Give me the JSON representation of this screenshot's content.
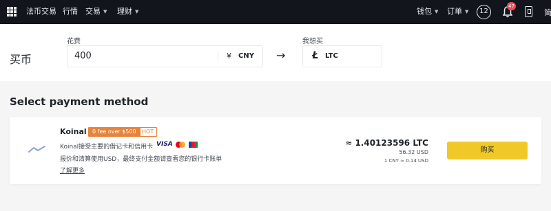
{
  "nav": {
    "left_items": [
      "法币交易",
      "行情",
      "交易",
      "理财"
    ],
    "wallet": "钱包",
    "orders": "订单",
    "circle_badge": "12",
    "notification_count": "47",
    "language": "简"
  },
  "buy": {
    "title": "买币",
    "spend_label": "花费",
    "spend_value": "400",
    "currency_symbol": "¥",
    "currency": "CNY",
    "want_label": "我想买",
    "crypto": "LTC"
  },
  "payment": {
    "section_title": "Select payment method",
    "method": {
      "name": "Koinal",
      "promo_badge": "0 fee over $500",
      "hot_badge": "HOT",
      "description": "Koinal接受主要的借记卡和信用卡",
      "card_brand_visa": "VISA",
      "note": "报价和清算使用USD，最终支付金额请查看您的银行卡账单",
      "learn_more": "了解更多",
      "crypto_amount": "≈ 1.40123596 LTC",
      "usd_amount": "56.32 USD",
      "rate": "1 CNY ≈ 0.14 USD",
      "buy_button": "购买"
    }
  },
  "colors": {
    "nav_bg": "#12161c",
    "accent_yellow": "#f0c929",
    "promo_orange": "#e8833a",
    "notification_red": "#f6465d"
  },
  "icons": {
    "apps": "grid-icon",
    "bell": "bell-icon",
    "device": "download-icon",
    "arrow": "arrow-right-icon",
    "crypto": "litecoin-icon",
    "method": "chart-line-icon"
  }
}
